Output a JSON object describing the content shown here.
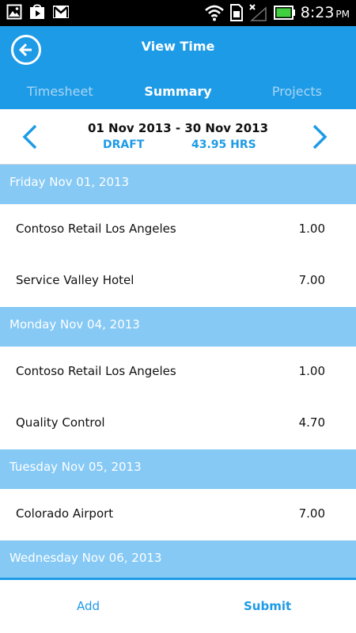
{
  "colors": {
    "accent": "#1e9be6",
    "day_header": "#86c9f5",
    "battery": "#3fcf3f"
  },
  "status_bar": {
    "time": "8:23",
    "ampm": "PM",
    "icons": [
      "gallery-icon",
      "play-store-icon",
      "gmail-icon",
      "wifi-icon",
      "sim-icon",
      "no-signal-icon",
      "battery-icon"
    ]
  },
  "header": {
    "title": "View Time",
    "back_icon": "back-arrow-icon",
    "tabs": [
      {
        "label": "Timesheet",
        "active": false
      },
      {
        "label": "Summary",
        "active": true
      },
      {
        "label": "Projects",
        "active": false
      }
    ]
  },
  "period": {
    "range": "01 Nov 2013 - 30 Nov 2013",
    "status": "DRAFT",
    "hours": "43.95 HRS"
  },
  "days": [
    {
      "date": "Friday Nov 01, 2013",
      "entries": [
        {
          "name": "Contoso Retail Los Angeles",
          "hours": "1.00"
        },
        {
          "name": "Service Valley Hotel",
          "hours": "7.00"
        }
      ]
    },
    {
      "date": "Monday Nov 04, 2013",
      "entries": [
        {
          "name": "Contoso Retail Los Angeles",
          "hours": "1.00"
        },
        {
          "name": "Quality Control",
          "hours": "4.70"
        }
      ]
    },
    {
      "date": "Tuesday Nov 05, 2013",
      "entries": [
        {
          "name": "Colorado Airport",
          "hours": "7.00"
        }
      ]
    },
    {
      "date": "Wednesday Nov 06, 2013",
      "entries": []
    }
  ],
  "bottom_bar": {
    "add_label": "Add",
    "submit_label": "Submit"
  }
}
